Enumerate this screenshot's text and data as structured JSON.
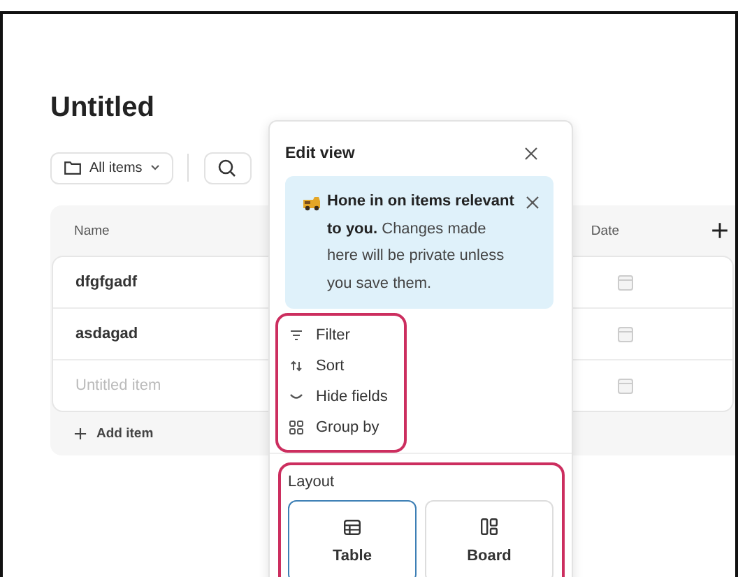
{
  "page": {
    "title": "Untitled",
    "view_button": "All items"
  },
  "table": {
    "columns": [
      "Name",
      "Date"
    ],
    "rows": [
      {
        "name": "dfgfgadf",
        "placeholder": false
      },
      {
        "name": "asdagad",
        "placeholder": false
      },
      {
        "name": "Untitled item",
        "placeholder": true
      }
    ],
    "add_item": "Add item"
  },
  "edit_view": {
    "title": "Edit view",
    "info": "**Hone in on items relevant to you.** Changes made here will be private unless you save them.",
    "menu_highlighted": true,
    "menu": [
      {
        "kind": "filter",
        "label": "Filter"
      },
      {
        "kind": "sort",
        "label": "Sort"
      },
      {
        "kind": "hide",
        "label": "Hide fields"
      },
      {
        "kind": "group",
        "label": "Group by"
      }
    ],
    "layout": {
      "heading": "Layout",
      "highlighted": true,
      "options": [
        {
          "kind": "table",
          "label": "Table",
          "selected": true
        },
        {
          "kind": "board",
          "label": "Board",
          "selected": false
        }
      ]
    }
  }
}
